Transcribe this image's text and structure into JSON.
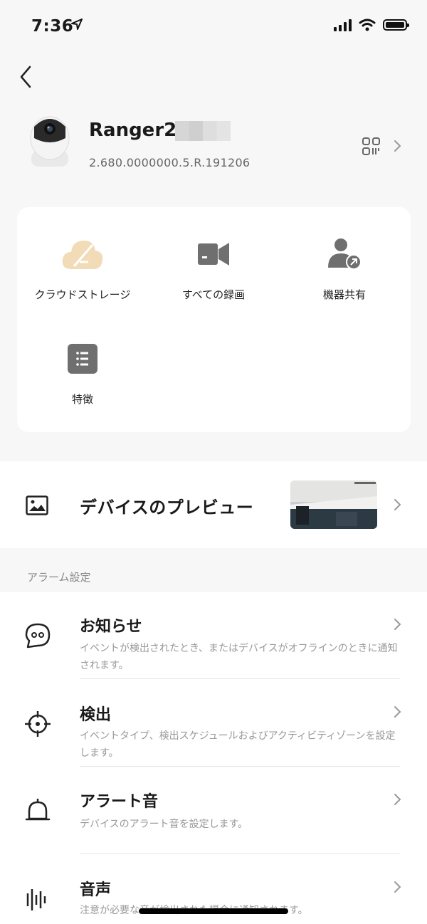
{
  "status_bar": {
    "time": "7:36"
  },
  "device": {
    "name": "Ranger2-",
    "version": "2.680.0000000.5.R.191206"
  },
  "quick_actions": [
    {
      "label": "クラウドストレージ",
      "icon": "cloud-storage-icon"
    },
    {
      "label": "すべての録画",
      "icon": "video-camera-icon"
    },
    {
      "label": "機器共有",
      "icon": "share-user-icon"
    },
    {
      "label": "特徴",
      "icon": "feature-list-icon"
    }
  ],
  "preview": {
    "title": "デバイスのプレビュー"
  },
  "alarm_section": {
    "label": "アラーム設定",
    "items": [
      {
        "title": "お知らせ",
        "desc": "イベントが検出されたとき、またはデバイスがオフラインのときに通知されます。",
        "icon": "chat-bubble-icon"
      },
      {
        "title": "検出",
        "desc": "イベントタイプ、検出スケジュールおよびアクティビティゾーンを設定します。",
        "icon": "crosshair-icon"
      },
      {
        "title": "アラート音",
        "desc": "デバイスのアラート音を設定します。",
        "icon": "bell-icon"
      },
      {
        "title": "音声",
        "desc": "注意が必要な音が検出された場合に通知されます。",
        "icon": "sound-wave-icon"
      }
    ]
  },
  "colors": {
    "accent_cloud": "#f2dcb8",
    "icon_gray": "#6f6f6f"
  }
}
